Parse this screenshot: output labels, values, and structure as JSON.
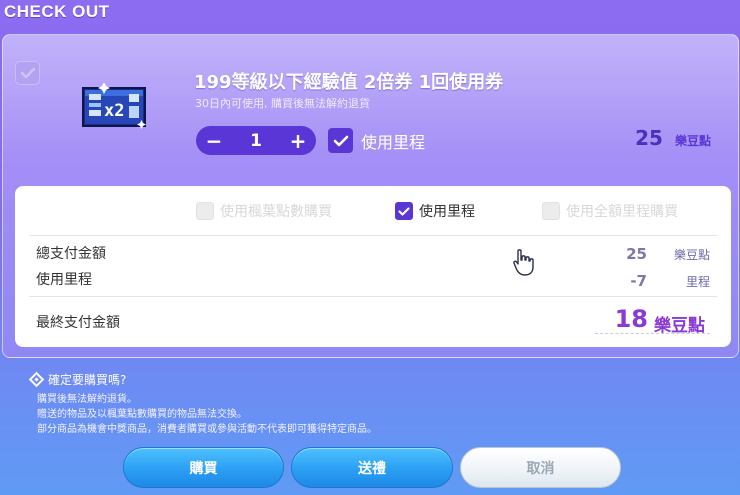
{
  "header": {
    "title": "CHECK OUT"
  },
  "item": {
    "name": "199等級以下經驗值 2倍券 1回使用券",
    "description": "30日內可使用, 購買後無法解約退貨",
    "quantity": "1",
    "decrement_label": "−",
    "increment_label": "+",
    "use_mileage_label": "使用里程",
    "price": "25",
    "price_unit": "樂豆點"
  },
  "payment_options": {
    "option_1": "使用楓葉點數購買",
    "option_2": "使用里程",
    "option_3": "使用全額里程購買"
  },
  "summary": {
    "total_label": "總支付金額",
    "total_value": "25",
    "total_unit": "樂豆點",
    "mileage_label": "使用里程",
    "mileage_value": "-7",
    "mileage_unit": "里程",
    "final_label": "最終支付金額",
    "final_value": "18",
    "final_unit": "樂豆點"
  },
  "notice": {
    "title": "確定要購買嗎?",
    "lines": [
      "購買後無法解約退貨。",
      "贈送的物品及以楓葉點數購買的物品無法交換。",
      "部分商品為機會中獎商品，消費者購買或參與活動不代表即可獲得特定商品。"
    ]
  },
  "buttons": {
    "buy": "購買",
    "gift": "送禮",
    "cancel": "取消"
  },
  "colors": {
    "accent_purple": "#5b36d6",
    "final_price_purple": "#8a38d6",
    "button_blue": "#2a9ff3"
  }
}
